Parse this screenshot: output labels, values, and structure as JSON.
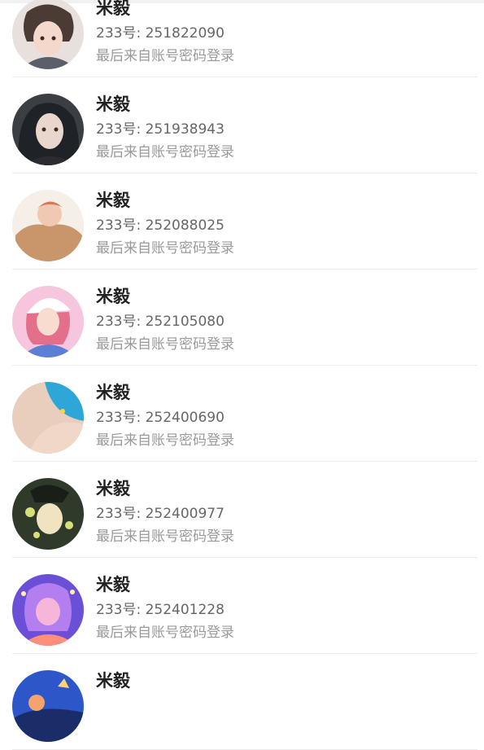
{
  "accounts": [
    {
      "name": "米毅",
      "uid": "233号: 251822090",
      "status": "最后来自账号密码登录",
      "avatar_bg": "#e8e0dc",
      "avatar_fg": "#4a3b34",
      "avatar_icon": "avatar-dark-hair"
    },
    {
      "name": "米毅",
      "uid": "233号: 251938943",
      "status": "最后来自账号密码登录",
      "avatar_bg": "#3b3f44",
      "avatar_fg": "#e9d6cc",
      "avatar_icon": "avatar-black-hair"
    },
    {
      "name": "米毅",
      "uid": "233号: 252088025",
      "status": "最后来自账号密码登录",
      "avatar_bg": "#f6efe7",
      "avatar_fg": "#c9956a",
      "avatar_icon": "avatar-brown-sweater"
    },
    {
      "name": "米毅",
      "uid": "233号: 252105080",
      "status": "最后来自账号密码登录",
      "avatar_bg": "#f5c6dd",
      "avatar_fg": "#5b7fd6",
      "avatar_icon": "avatar-pink-hair-cap"
    },
    {
      "name": "米毅",
      "uid": "233号: 252400690",
      "status": "最后来自账号密码登录",
      "avatar_bg": "#e9cdbd",
      "avatar_fg": "#2fa6d8",
      "avatar_icon": "avatar-blue-hair"
    },
    {
      "name": "米毅",
      "uid": "233号: 252400977",
      "status": "最后来自账号密码登录",
      "avatar_bg": "#2f3a2a",
      "avatar_fg": "#d6e07a",
      "avatar_icon": "avatar-green-glow"
    },
    {
      "name": "米毅",
      "uid": "233号: 252401228",
      "status": "最后来自账号密码登录",
      "avatar_bg": "#6b4fd6",
      "avatar_fg": "#f6b6d9",
      "avatar_icon": "avatar-purple-hair"
    },
    {
      "name": "米毅",
      "uid": "",
      "status": "",
      "avatar_bg": "#2d56c9",
      "avatar_fg": "#f3a36b",
      "avatar_icon": "avatar-blue-scene"
    }
  ]
}
